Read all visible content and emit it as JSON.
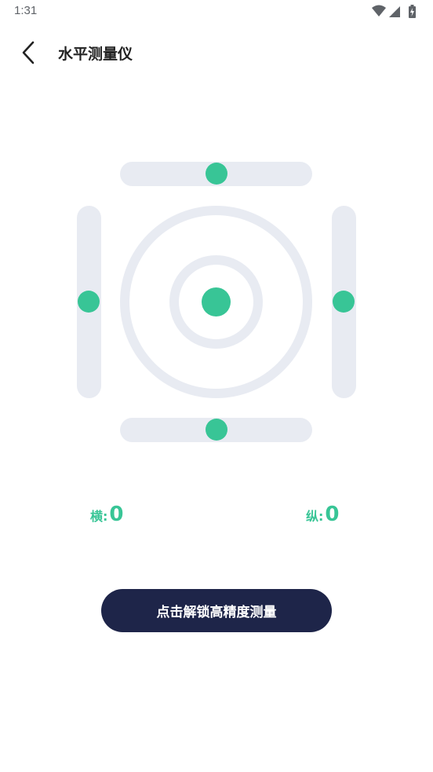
{
  "status_bar": {
    "time": "1:31",
    "icons": [
      "wifi-icon",
      "cellular-signal-icon",
      "battery-icon"
    ]
  },
  "header": {
    "back_icon": "chevron-left-icon",
    "title": "水平测量仪"
  },
  "level": {
    "horizontal_label": "横:",
    "horizontal_value": "0",
    "vertical_label": "纵:",
    "vertical_value": "0"
  },
  "actions": {
    "unlock_label": "点击解锁高精度测量"
  },
  "colors": {
    "accent": "#38c596",
    "track": "#e8ebf2",
    "button_bg": "#1e2549",
    "title_text": "#222222"
  }
}
